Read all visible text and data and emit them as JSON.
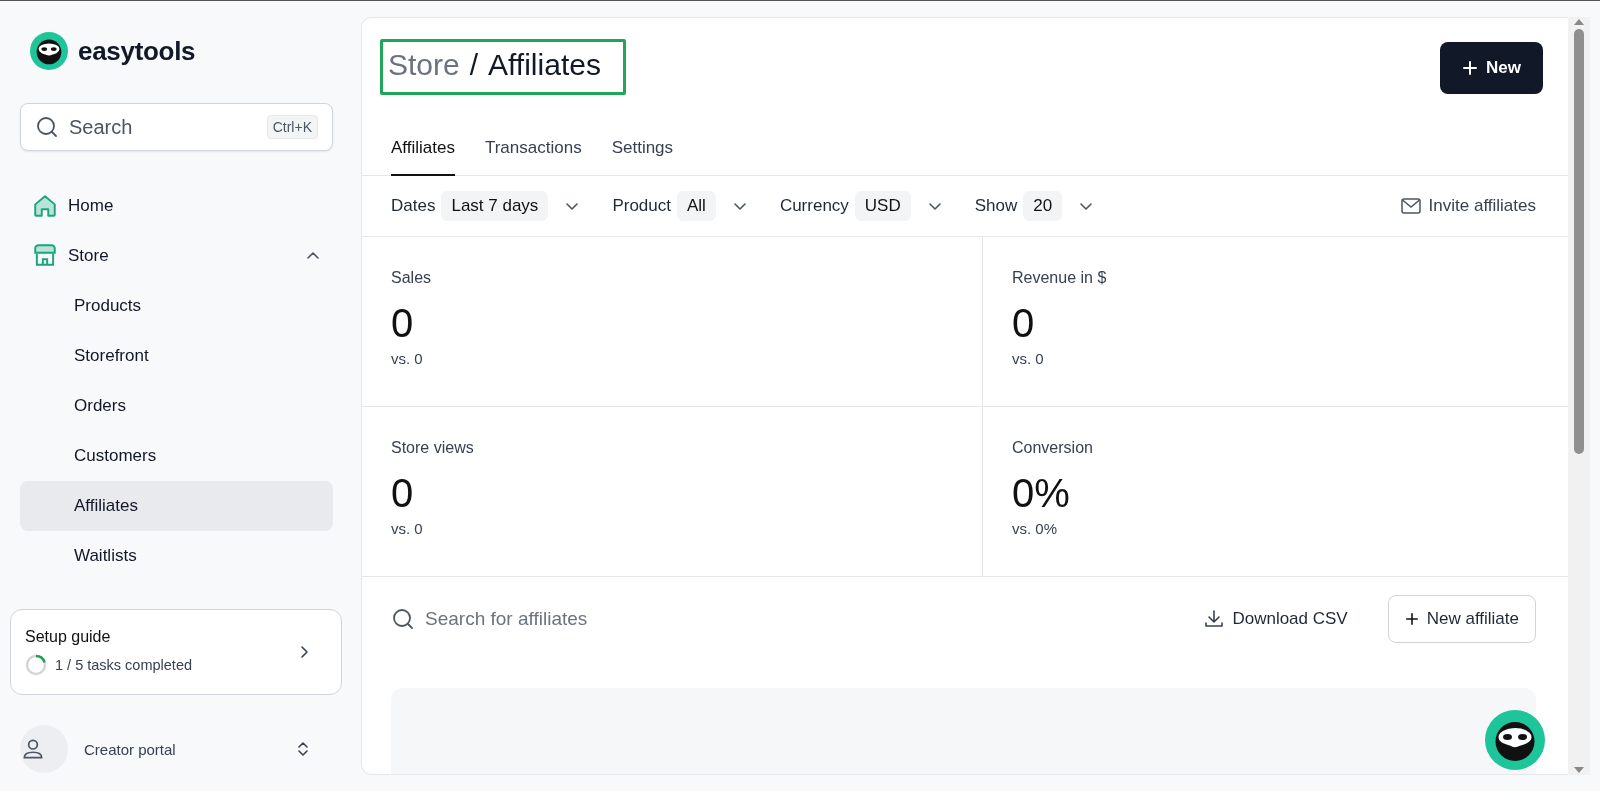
{
  "brand": {
    "name": "easytools"
  },
  "search": {
    "placeholder": "Search",
    "shortcut": "Ctrl+K"
  },
  "nav": [
    {
      "kind": "link",
      "label": "Home"
    },
    {
      "kind": "group",
      "label": "Store",
      "expanded": true,
      "children": [
        {
          "label": "Products",
          "selected": false
        },
        {
          "label": "Storefront",
          "selected": false
        },
        {
          "label": "Orders",
          "selected": false
        },
        {
          "label": "Customers",
          "selected": false
        },
        {
          "label": "Affiliates",
          "selected": true
        },
        {
          "label": "Waitlists",
          "selected": false
        }
      ]
    }
  ],
  "setup_guide": {
    "title": "Setup guide",
    "progress_text": "1 / 5 tasks completed",
    "level": 0.2
  },
  "account": {
    "label": "Creator portal"
  },
  "breadcrumb": {
    "separator": "/",
    "items": [
      {
        "label": "Store",
        "current": false
      },
      {
        "label": "Affiliates",
        "current": true
      }
    ]
  },
  "new_button": {
    "label": "New"
  },
  "tabs": [
    {
      "label": "Affiliates",
      "selected": true
    },
    {
      "label": "Transactions",
      "selected": false
    },
    {
      "label": "Settings",
      "selected": false
    }
  ],
  "filters": [
    {
      "label": "Dates",
      "value": "Last 7 days"
    },
    {
      "label": "Product",
      "value": "All"
    },
    {
      "label": "Currency",
      "value": "USD"
    },
    {
      "label": "Show",
      "value": "20"
    }
  ],
  "invite": {
    "label": "Invite affiliates"
  },
  "stats": [
    {
      "label": "Sales",
      "value": "0",
      "comparison": "vs. 0"
    },
    {
      "label": "Revenue in $",
      "value": "0",
      "comparison": "vs. 0"
    },
    {
      "label": "Store views",
      "value": "0",
      "comparison": "vs. 0"
    },
    {
      "label": "Conversion",
      "value": "0%",
      "comparison": "vs. 0%"
    }
  ],
  "table_toolbar": {
    "search_placeholder": "Search for affiliates",
    "download": "Download CSV",
    "new": "New affiliate"
  }
}
